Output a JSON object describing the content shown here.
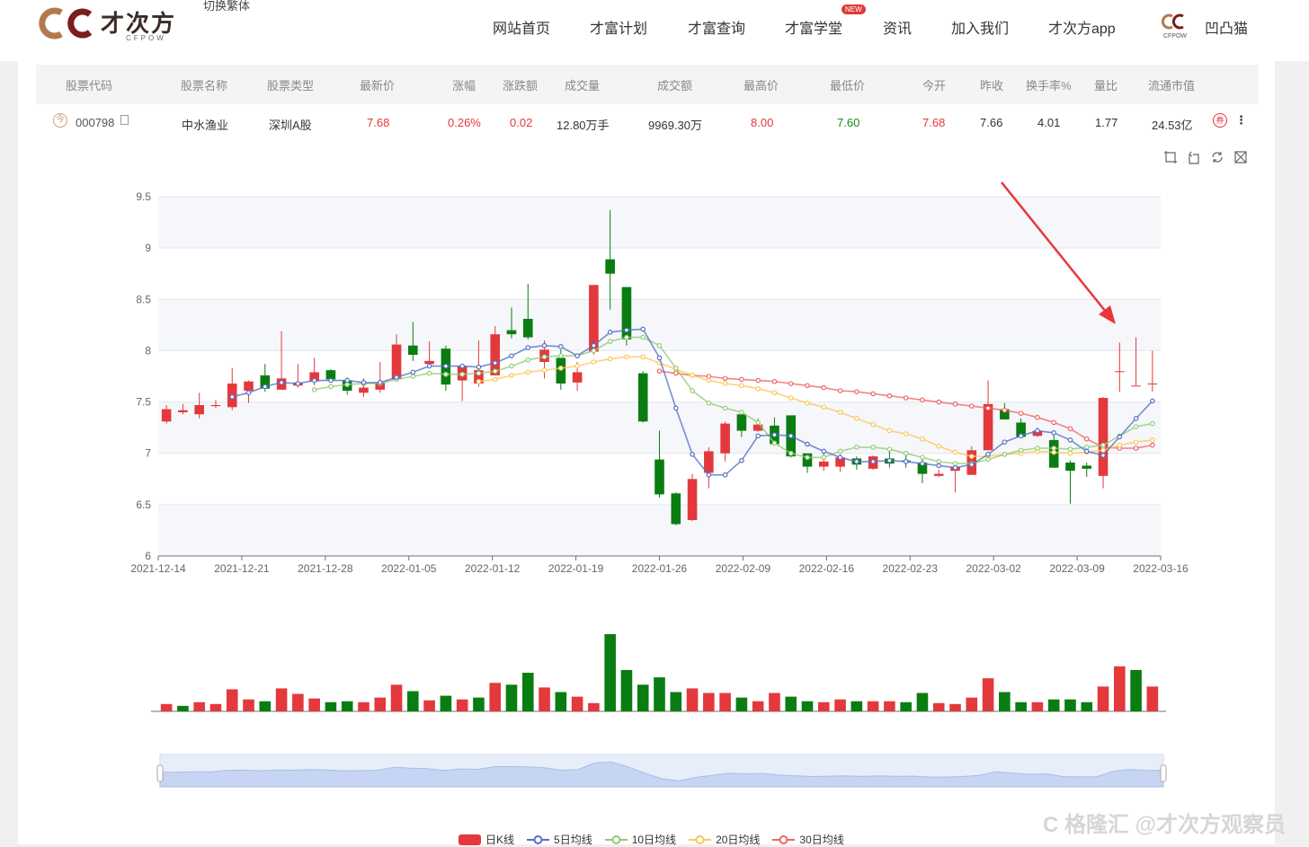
{
  "header": {
    "logo_text": "才次方",
    "logo_sub": "CFPOW",
    "switch_traditional": "切换繁体",
    "nav": [
      {
        "label": "网站首页"
      },
      {
        "label": "才富计划"
      },
      {
        "label": "才富查询"
      },
      {
        "label": "才富学堂",
        "badge": "NEW"
      },
      {
        "label": "资讯"
      },
      {
        "label": "加入我们"
      },
      {
        "label": "才次方app"
      }
    ],
    "user_name": "凹凸猫",
    "user_logo_sub": "CFPOW"
  },
  "table": {
    "columns": [
      "股票代码",
      "股票名称",
      "股票类型",
      "最新价",
      "涨幅",
      "涨跌额",
      "成交量",
      "成交额",
      "最高价",
      "最低价",
      "今开",
      "昨收",
      "换手率%",
      "量比",
      "流通市值"
    ],
    "row": {
      "code": "000798",
      "name": "中水渔业",
      "type": "深圳A股",
      "latest": "7.68",
      "change_pct": "0.26%",
      "change_amt": "0.02",
      "volume": "12.80万手",
      "turnover": "9969.30万",
      "high": "8.00",
      "low": "7.60",
      "open": "7.68",
      "prev_close": "7.66",
      "turnover_rate": "4.01",
      "volume_ratio": "1.77",
      "float_mcap": "24.53亿"
    },
    "icons": {
      "today": "今",
      "coupon": "券"
    }
  },
  "colors": {
    "up": "#e3393c",
    "down": "#0a7d12",
    "ma5": "#5470c6",
    "ma10": "#91cc75",
    "ma20": "#fac858",
    "ma30": "#ee6666"
  },
  "chart_data": {
    "type": "candlestick",
    "y_ticks": [
      "9.5",
      "9",
      "8.5",
      "8",
      "7.5",
      "7",
      "6.5",
      "6"
    ],
    "ylim": [
      6,
      9.5
    ],
    "x_tick_labels": [
      "2021-12-14",
      "2021-12-21",
      "2021-12-28",
      "2022-01-05",
      "2022-01-12",
      "2022-01-19",
      "2022-01-26",
      "2022-02-09",
      "2022-02-16",
      "2022-02-23",
      "2022-03-02",
      "2022-03-09",
      "2022-03-16"
    ],
    "candles": [
      [
        7.31,
        7.43,
        7.29,
        7.47
      ],
      [
        7.4,
        7.42,
        7.38,
        7.48
      ],
      [
        7.38,
        7.47,
        7.34,
        7.59
      ],
      [
        7.46,
        7.47,
        7.44,
        7.52
      ],
      [
        7.45,
        7.68,
        7.42,
        7.83
      ],
      [
        7.61,
        7.7,
        7.49,
        7.71
      ],
      [
        7.76,
        7.63,
        7.6,
        7.87
      ],
      [
        7.62,
        7.73,
        7.62,
        8.19
      ],
      [
        7.66,
        7.69,
        7.64,
        7.87
      ],
      [
        7.7,
        7.79,
        7.66,
        7.93
      ],
      [
        7.81,
        7.72,
        7.7,
        7.82
      ],
      [
        7.71,
        7.61,
        7.57,
        7.74
      ],
      [
        7.59,
        7.64,
        7.55,
        7.73
      ],
      [
        7.62,
        7.69,
        7.59,
        7.89
      ],
      [
        7.72,
        8.06,
        7.71,
        8.16
      ],
      [
        8.05,
        7.96,
        7.9,
        8.28
      ],
      [
        7.87,
        7.9,
        7.84,
        8.09
      ],
      [
        8.02,
        7.67,
        7.61,
        8.05
      ],
      [
        7.71,
        7.85,
        7.51,
        7.87
      ],
      [
        7.68,
        7.81,
        7.65,
        8.1
      ],
      [
        7.76,
        8.16,
        7.76,
        8.24
      ],
      [
        8.2,
        8.16,
        8.12,
        8.42
      ],
      [
        8.31,
        8.13,
        8.11,
        8.65
      ],
      [
        7.89,
        8.01,
        7.73,
        8.1
      ],
      [
        7.93,
        7.68,
        7.62,
        8.01
      ],
      [
        7.69,
        7.79,
        7.61,
        7.89
      ],
      [
        7.99,
        8.64,
        7.96,
        8.64
      ],
      [
        8.89,
        8.75,
        8.4,
        9.37
      ],
      [
        8.62,
        8.11,
        8.05,
        8.62
      ],
      [
        7.78,
        7.31,
        7.3,
        7.8
      ],
      [
        6.94,
        6.6,
        6.57,
        7.22
      ],
      [
        6.61,
        6.31,
        6.3,
        6.62
      ],
      [
        6.35,
        6.75,
        6.34,
        6.8
      ],
      [
        6.81,
        7.02,
        6.66,
        7.06
      ],
      [
        7.0,
        7.29,
        6.92,
        7.31
      ],
      [
        7.38,
        7.22,
        7.16,
        7.42
      ],
      [
        7.22,
        7.28,
        7.21,
        7.34
      ],
      [
        7.27,
        7.09,
        7.08,
        7.35
      ],
      [
        7.37,
        6.97,
        6.96,
        7.37
      ],
      [
        7.0,
        6.87,
        6.81,
        7.0
      ],
      [
        6.87,
        6.92,
        6.83,
        7.0
      ],
      [
        6.87,
        6.96,
        6.82,
        6.99
      ],
      [
        6.95,
        6.89,
        6.84,
        6.97
      ],
      [
        6.85,
        6.97,
        6.84,
        6.98
      ],
      [
        6.95,
        6.9,
        6.86,
        7.02
      ],
      [
        6.93,
        6.92,
        6.86,
        6.98
      ],
      [
        6.91,
        6.8,
        6.71,
        6.98
      ],
      [
        6.78,
        6.8,
        6.77,
        6.84
      ],
      [
        6.83,
        6.87,
        6.62,
        6.87
      ],
      [
        6.79,
        7.03,
        6.79,
        7.07
      ],
      [
        7.03,
        7.48,
        7.03,
        7.71
      ],
      [
        7.43,
        7.33,
        7.33,
        7.49
      ],
      [
        7.3,
        7.16,
        7.15,
        7.34
      ],
      [
        7.17,
        7.22,
        7.16,
        7.25
      ],
      [
        7.13,
        6.86,
        6.86,
        7.21
      ],
      [
        6.91,
        6.83,
        6.51,
        6.93
      ],
      [
        6.88,
        6.85,
        6.77,
        6.91
      ],
      [
        6.78,
        7.54,
        6.66,
        7.55
      ],
      [
        7.8,
        7.8,
        7.6,
        8.08
      ],
      [
        7.66,
        7.66,
        7.66,
        8.13
      ],
      [
        7.68,
        7.68,
        7.6,
        8.0
      ]
    ],
    "volume": [
      {
        "v": 8,
        "up": true
      },
      {
        "v": 6,
        "up": false
      },
      {
        "v": 10,
        "up": true
      },
      {
        "v": 8,
        "up": true
      },
      {
        "v": 24,
        "up": true
      },
      {
        "v": 13,
        "up": true
      },
      {
        "v": 11,
        "up": false
      },
      {
        "v": 25,
        "up": true
      },
      {
        "v": 19,
        "up": true
      },
      {
        "v": 14,
        "up": true
      },
      {
        "v": 10,
        "up": false
      },
      {
        "v": 11,
        "up": false
      },
      {
        "v": 10,
        "up": true
      },
      {
        "v": 15,
        "up": true
      },
      {
        "v": 29,
        "up": true
      },
      {
        "v": 22,
        "up": false
      },
      {
        "v": 12,
        "up": true
      },
      {
        "v": 17,
        "up": false
      },
      {
        "v": 13,
        "up": true
      },
      {
        "v": 15,
        "up": false
      },
      {
        "v": 31,
        "up": true
      },
      {
        "v": 29,
        "up": false
      },
      {
        "v": 42,
        "up": false
      },
      {
        "v": 26,
        "up": true
      },
      {
        "v": 21,
        "up": false
      },
      {
        "v": 16,
        "up": true
      },
      {
        "v": 9,
        "up": true
      },
      {
        "v": 84,
        "up": false
      },
      {
        "v": 45,
        "up": false
      },
      {
        "v": 29,
        "up": false
      },
      {
        "v": 37,
        "up": false
      },
      {
        "v": 21,
        "up": false
      },
      {
        "v": 25,
        "up": true
      },
      {
        "v": 20,
        "up": true
      },
      {
        "v": 20,
        "up": true
      },
      {
        "v": 15,
        "up": false
      },
      {
        "v": 11,
        "up": true
      },
      {
        "v": 20,
        "up": true
      },
      {
        "v": 16,
        "up": false
      },
      {
        "v": 11,
        "up": false
      },
      {
        "v": 10,
        "up": true
      },
      {
        "v": 13,
        "up": true
      },
      {
        "v": 11,
        "up": false
      },
      {
        "v": 11,
        "up": true
      },
      {
        "v": 11,
        "up": true
      },
      {
        "v": 10,
        "up": false
      },
      {
        "v": 20,
        "up": false
      },
      {
        "v": 9,
        "up": true
      },
      {
        "v": 8,
        "up": true
      },
      {
        "v": 15,
        "up": true
      },
      {
        "v": 36,
        "up": true
      },
      {
        "v": 21,
        "up": false
      },
      {
        "v": 10,
        "up": false
      },
      {
        "v": 10,
        "up": true
      },
      {
        "v": 13,
        "up": false
      },
      {
        "v": 13,
        "up": false
      },
      {
        "v": 10,
        "up": false
      },
      {
        "v": 27,
        "up": true
      },
      {
        "v": 49,
        "up": true
      },
      {
        "v": 45,
        "up": false
      },
      {
        "v": 27,
        "up": true
      }
    ],
    "ma5": [
      null,
      null,
      null,
      null,
      7.55,
      7.59,
      7.65,
      7.69,
      7.68,
      7.71,
      7.71,
      7.71,
      7.69,
      7.69,
      7.74,
      7.79,
      7.85,
      7.85,
      7.85,
      7.84,
      7.88,
      7.95,
      8.03,
      8.05,
      8.04,
      7.95,
      8.05,
      8.18,
      8.2,
      8.21,
      7.93,
      7.44,
      6.99,
      6.79,
      6.79,
      6.93,
      7.17,
      7.18,
      7.17,
      7.09,
      7.02,
      6.96,
      6.92,
      6.92,
      6.93,
      6.92,
      6.9,
      6.88,
      6.86,
      6.89,
      6.99,
      7.11,
      7.17,
      7.22,
      7.2,
      7.13,
      7.02,
      6.98,
      7.16,
      7.34,
      7.51
    ],
    "ma10": [
      null,
      null,
      null,
      null,
      null,
      null,
      null,
      null,
      null,
      7.62,
      7.65,
      7.67,
      7.68,
      7.68,
      7.72,
      7.75,
      7.78,
      7.77,
      7.77,
      7.78,
      7.8,
      7.85,
      7.91,
      7.94,
      7.95,
      7.95,
      8.0,
      8.09,
      8.13,
      8.13,
      8.05,
      7.83,
      7.61,
      7.49,
      7.44,
      7.4,
      7.3,
      7.1,
      7.0,
      6.96,
      6.96,
      7.02,
      7.06,
      7.06,
      7.04,
      7.0,
      6.96,
      6.92,
      6.9,
      6.9,
      6.94,
      6.99,
      7.03,
      7.05,
      7.05,
      7.04,
      7.06,
      7.08,
      7.17,
      7.26,
      7.29
    ],
    "ma20": [
      null,
      null,
      null,
      null,
      null,
      null,
      null,
      null,
      null,
      null,
      null,
      null,
      null,
      null,
      null,
      null,
      null,
      null,
      null,
      7.7,
      7.72,
      7.76,
      7.79,
      7.81,
      7.83,
      7.85,
      7.89,
      7.92,
      7.94,
      7.94,
      7.88,
      7.82,
      7.76,
      7.71,
      7.68,
      7.66,
      7.63,
      7.59,
      7.54,
      7.49,
      7.45,
      7.4,
      7.34,
      7.28,
      7.22,
      7.19,
      7.14,
      7.07,
      7.01,
      6.97,
      6.97,
      6.99,
      7.0,
      7.02,
      7.01,
      7.0,
      7.01,
      7.03,
      7.08,
      7.11,
      7.13
    ],
    "ma30": [
      null,
      null,
      null,
      null,
      null,
      null,
      null,
      null,
      null,
      null,
      null,
      null,
      null,
      null,
      null,
      null,
      null,
      null,
      null,
      null,
      null,
      null,
      null,
      null,
      null,
      null,
      null,
      null,
      null,
      null,
      7.8,
      7.78,
      7.76,
      7.75,
      7.73,
      7.72,
      7.71,
      7.7,
      7.68,
      7.66,
      7.64,
      7.61,
      7.6,
      7.58,
      7.56,
      7.54,
      7.52,
      7.5,
      7.48,
      7.46,
      7.44,
      7.42,
      7.39,
      7.35,
      7.3,
      7.24,
      7.14,
      7.06,
      7.05,
      7.05,
      7.08
    ],
    "legend": [
      "日K线",
      "5日均线",
      "10日均线",
      "20日均线",
      "30日均线"
    ]
  },
  "watermark": "C 格隆汇 @才次方观察员"
}
